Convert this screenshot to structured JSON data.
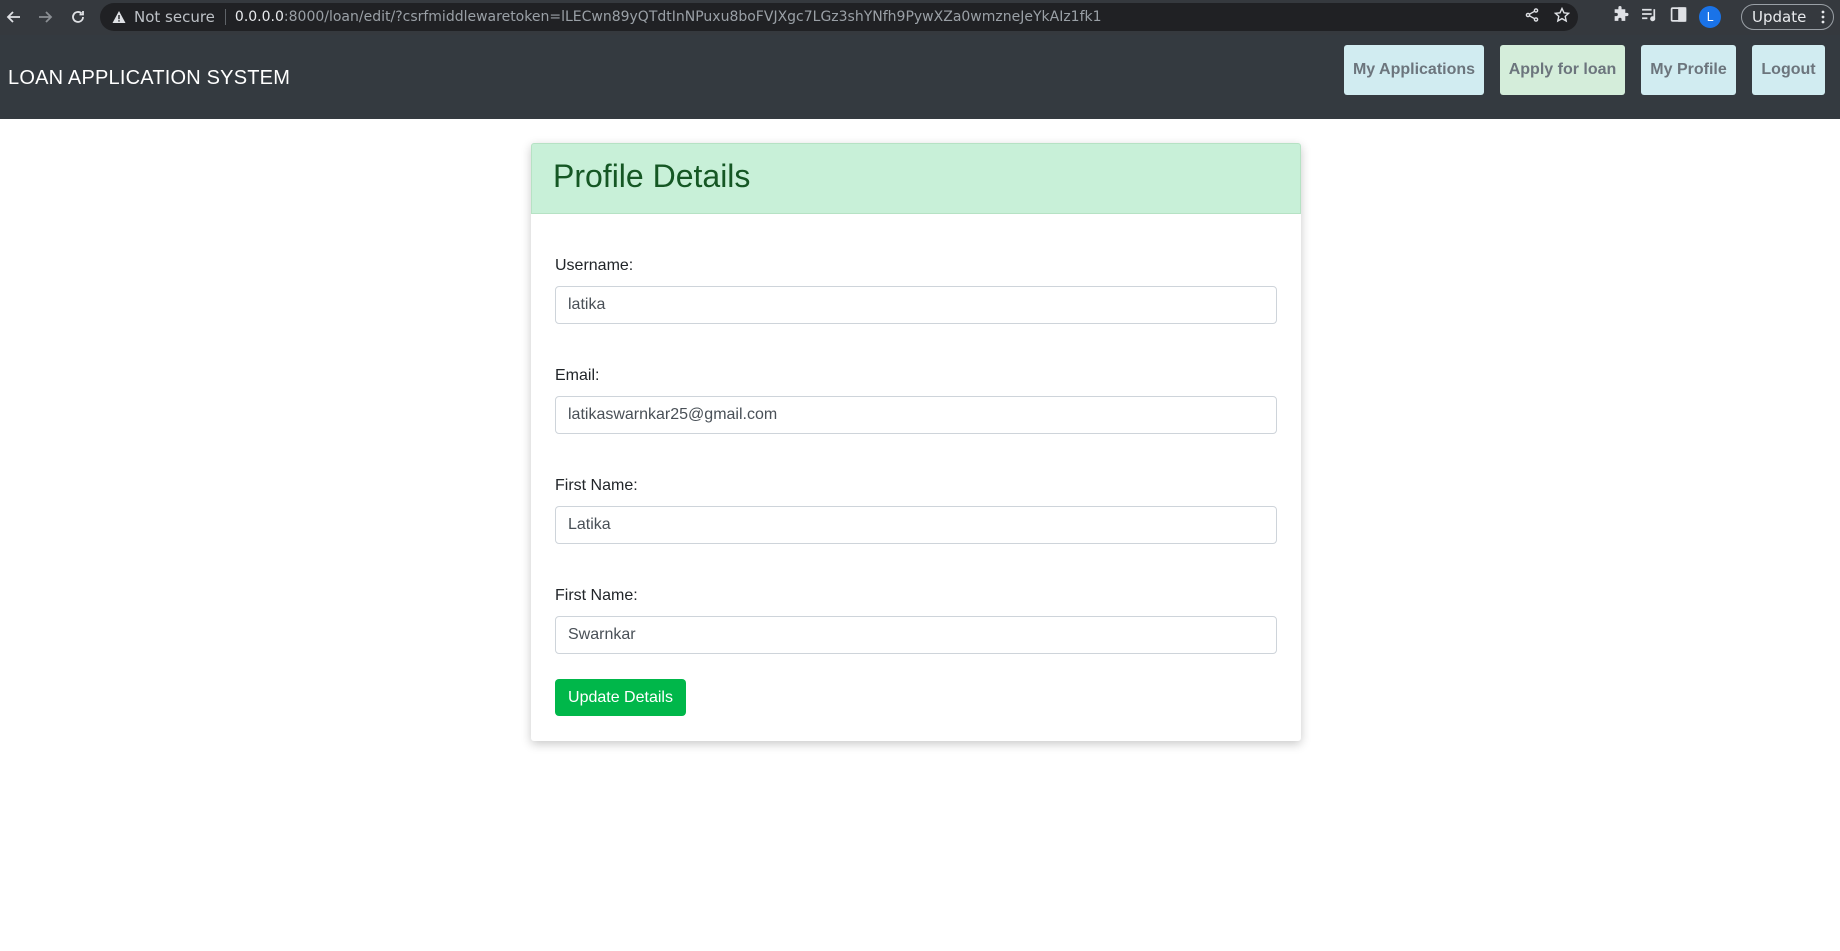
{
  "browser": {
    "security_label": "Not secure",
    "url_host": "0.0.0.0",
    "url_rest": ":8000/loan/edit/?csrfmiddlewaretoken=lLECwn89yQTdtInNPuxu8boFVJXgc7LGz3shYNfh9PywXZa0wmzneJeYkAIz1fk1",
    "profile_initial": "L",
    "update_label": "Update"
  },
  "navbar": {
    "brand": "LOAN APPLICATION SYSTEM",
    "links": {
      "my_applications": "My Applications",
      "apply_for_loan": "Apply for loan",
      "my_profile": "My Profile",
      "logout": "Logout"
    }
  },
  "profile": {
    "title": "Profile Details",
    "fields": [
      {
        "label": "Username:",
        "value": "latika"
      },
      {
        "label": "Email:",
        "value": "latikaswarnkar25@gmail.com"
      },
      {
        "label": "First Name:",
        "value": "Latika"
      },
      {
        "label": "First Name:",
        "value": "Swarnkar"
      }
    ],
    "submit_label": "Update Details"
  }
}
